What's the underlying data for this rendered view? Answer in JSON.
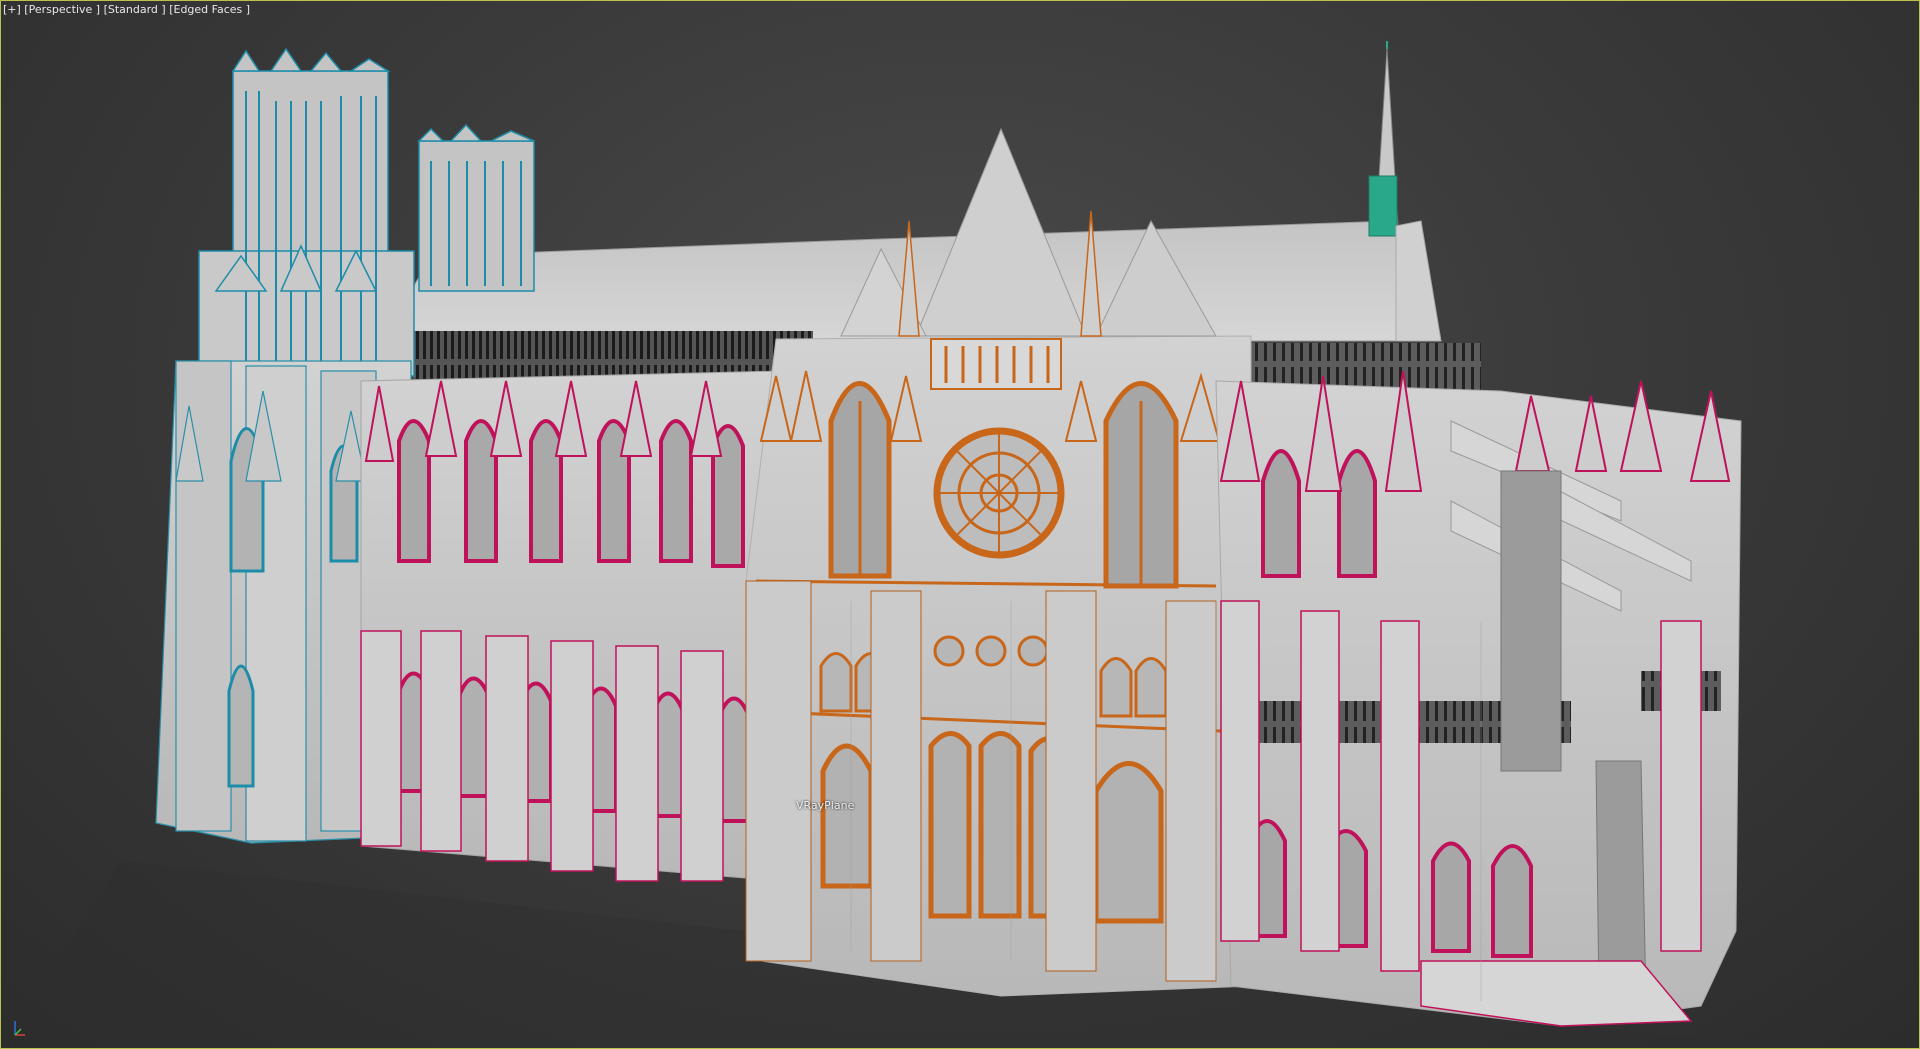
{
  "viewport": {
    "label": "[+] [Perspective ] [Standard ] [Edged Faces ]",
    "object_label": "VRayPlane",
    "colors": {
      "background": "#3b3b3b",
      "border": "#b9c24a",
      "base_gray": "#c8c8c8",
      "cyan_selection": "#2a8fa8",
      "magenta_selection": "#c0125a",
      "orange_selection": "#c8661a",
      "teal_spire": "#2aa88a"
    }
  },
  "axis_icon": {
    "name": "axis-tripod-icon"
  }
}
